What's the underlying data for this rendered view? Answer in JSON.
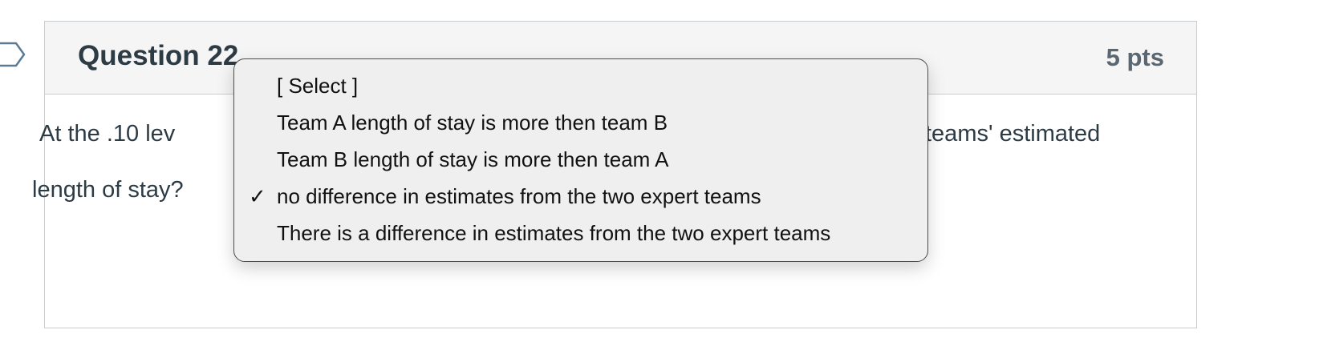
{
  "question": {
    "title": "Question 22",
    "points": "5 pts",
    "text_line1_start": "At the .10 lev",
    "text_line1_end": "teams' estimated",
    "text_line2": "length of stay?"
  },
  "dropdown": {
    "options": [
      {
        "label": "[ Select ]",
        "selected": false
      },
      {
        "label": "Team A length of stay is more then team B",
        "selected": false
      },
      {
        "label": "Team B length of stay is more then team A",
        "selected": false
      },
      {
        "label": "no difference in estimates from the two expert teams",
        "selected": true
      },
      {
        "label": "There is a difference in estimates from the two expert teams",
        "selected": false
      }
    ],
    "check_glyph": "✓"
  },
  "icons": {
    "bookmark": "bookmark-icon",
    "check": "check-icon"
  },
  "colors": {
    "text": "#2d3b45",
    "header_bg": "#f5f5f5",
    "border": "#c7cdd1",
    "menu_bg": "#efefef"
  }
}
